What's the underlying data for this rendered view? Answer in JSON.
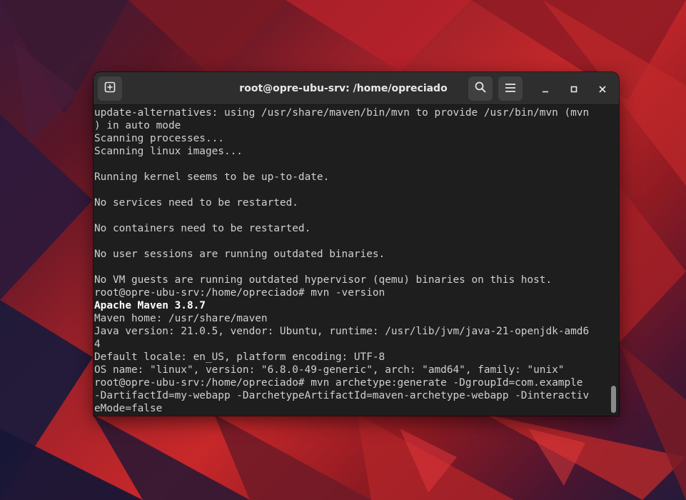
{
  "window": {
    "title": "root@opre-ubu-srv: /home/opreciado"
  },
  "headerbar": {
    "new_tab_icon": "new-tab-icon",
    "search_icon": "search-icon",
    "menu_icon": "hamburger-menu-icon",
    "minimize_icon": "minimize-icon",
    "maximize_icon": "maximize-icon",
    "close_icon": "close-icon"
  },
  "terminal": {
    "lines": [
      "update-alternatives: using /usr/share/maven/bin/mvn to provide /usr/bin/mvn (mvn",
      ") in auto mode",
      "Scanning processes...",
      "Scanning linux images...",
      "",
      "Running kernel seems to be up-to-date.",
      "",
      "No services need to be restarted.",
      "",
      "No containers need to be restarted.",
      "",
      "No user sessions are running outdated binaries.",
      "",
      "No VM guests are running outdated hypervisor (qemu) binaries on this host.",
      "root@opre-ubu-srv:/home/opreciado# mvn -version",
      "Apache Maven 3.8.7",
      "Maven home: /usr/share/maven",
      "Java version: 21.0.5, vendor: Ubuntu, runtime: /usr/lib/jvm/java-21-openjdk-amd6",
      "4",
      "Default locale: en_US, platform encoding: UTF-8",
      "OS name: \"linux\", version: \"6.8.0-49-generic\", arch: \"amd64\", family: \"unix\"",
      "root@opre-ubu-srv:/home/opreciado# mvn archetype:generate -DgroupId=com.example",
      "-DartifactId=my-webapp -DarchetypeArtifactId=maven-archetype-webapp -Dinteractiv",
      "eMode=false"
    ],
    "bold_line_index": 15
  },
  "colors": {
    "terminal_bg": "#1e1e1e",
    "headerbar_bg": "#2e2e2e",
    "text": "#d0d0d0",
    "wallpaper_accent": "#c8282a"
  }
}
